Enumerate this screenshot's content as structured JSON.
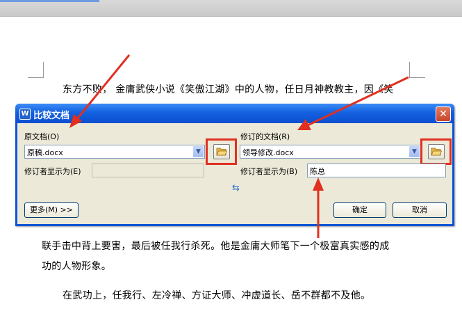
{
  "document": {
    "line1": "东方不败，  金庸武侠小说《笑傲江湖》中的人物，任日月神教教主，因《笑",
    "line2": "联手击中背上要害，最后被任我行杀死。他是金庸大师笔下一个极富真实感的成",
    "line3": "功的人物形象。",
    "line4": "在武功上，任我行、左冷禅、方证大师、冲虚道长、岳不群都不及他。"
  },
  "dialog": {
    "title": "比较文档",
    "close_glyph": "✕",
    "original": {
      "label": "原文档(O)",
      "value": "原稿.docx",
      "reviser_label": "修订者显示为(E)",
      "reviser_value": ""
    },
    "revised": {
      "label": "修订的文档(R)",
      "value": "领导修改.docx",
      "reviser_label": "修订者显示为(B)",
      "reviser_value": "陈总"
    },
    "swap_glyph": "⇆",
    "more_button": "更多(M) >>",
    "ok_button": "确定",
    "cancel_button": "取消"
  },
  "annotation": {
    "highlight_color": "#e03020"
  }
}
